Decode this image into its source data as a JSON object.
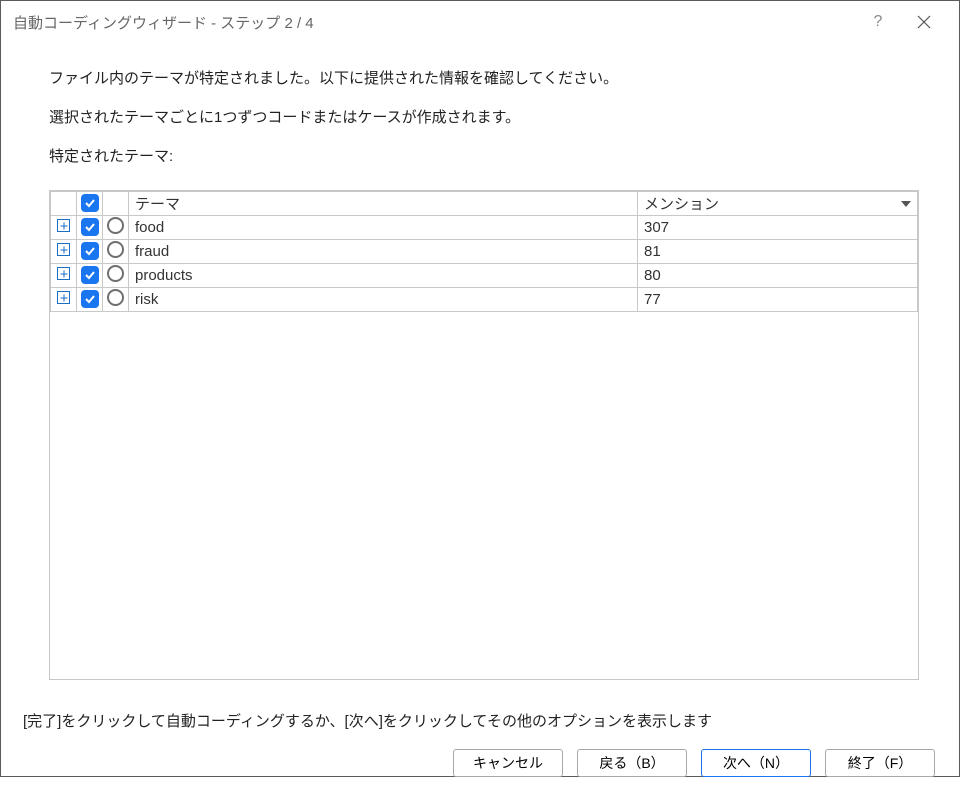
{
  "titlebar": {
    "title": "自動コーディングウィザード - ステップ 2 / 4",
    "help_label": "?",
    "close_label": "✕"
  },
  "intro": {
    "line1": "ファイル内のテーマが特定されました。以下に提供された情報を確認してください。",
    "line2": "選択されたテーマごとに1つずつコードまたはケースが作成されます。",
    "line3": "特定されたテーマ:"
  },
  "table": {
    "headers": {
      "theme": "テーマ",
      "mention": "メンション"
    },
    "rows": [
      {
        "theme": "food",
        "mention": "307",
        "checked": true
      },
      {
        "theme": "fraud",
        "mention": "81",
        "checked": true
      },
      {
        "theme": "products",
        "mention": "80",
        "checked": true
      },
      {
        "theme": "risk",
        "mention": "77",
        "checked": true
      }
    ]
  },
  "footer_text": "[完了]をクリックして自動コーディングするか、[次へ]をクリックしてその他のオプションを表示します",
  "buttons": {
    "cancel": "キャンセル",
    "back": "戻る（B）",
    "next": "次へ（N）",
    "finish": "終了（F）"
  }
}
